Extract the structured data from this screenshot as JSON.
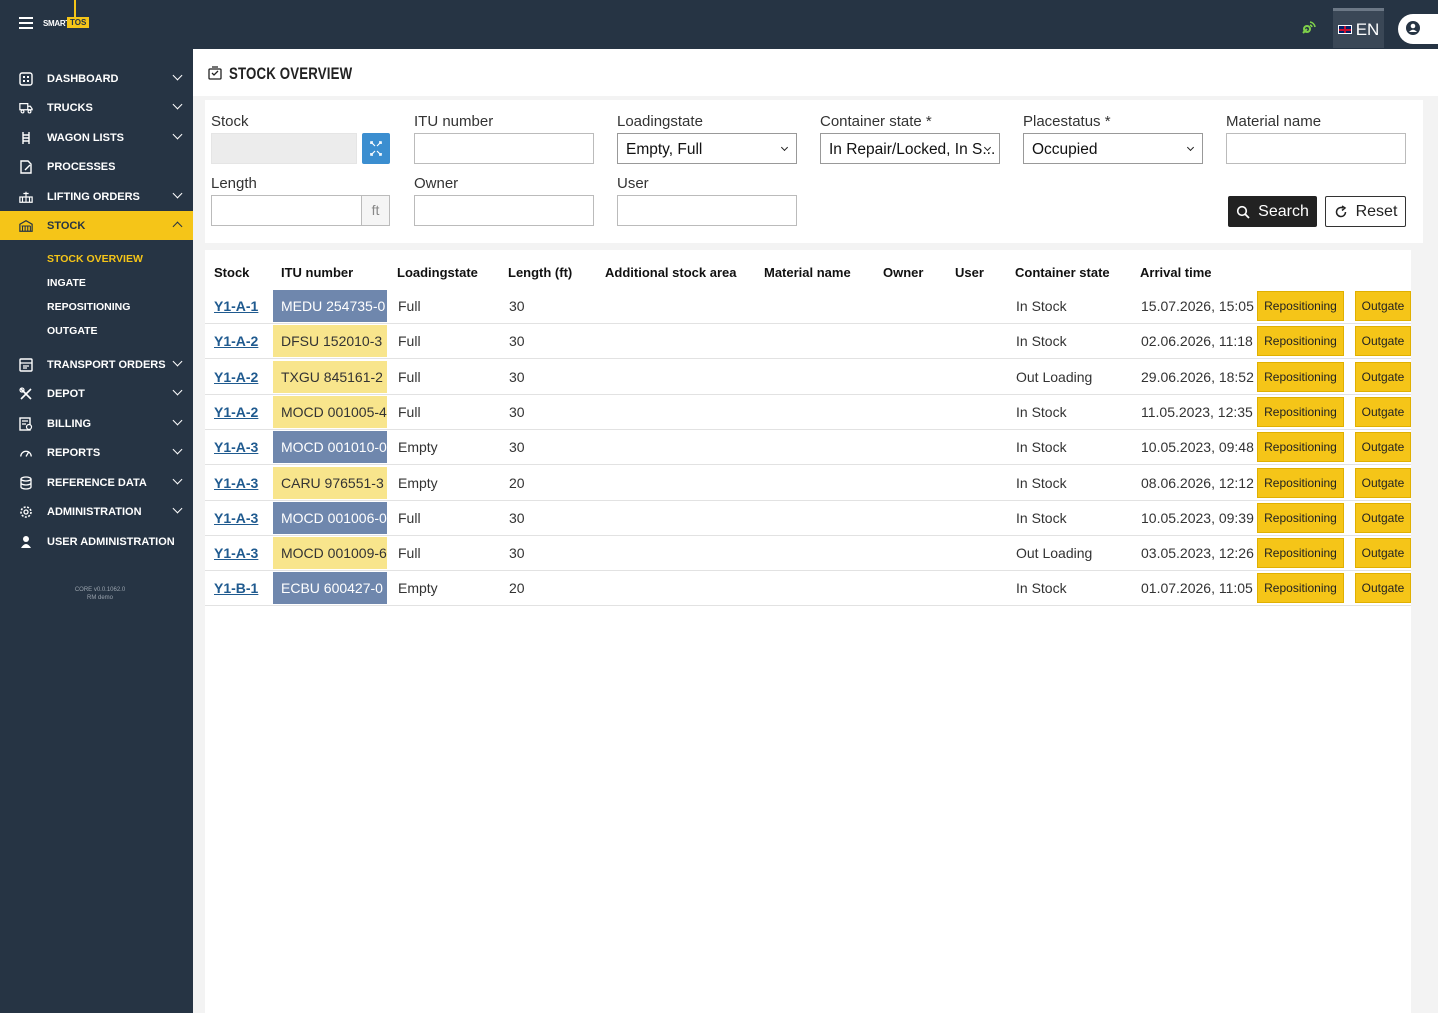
{
  "app": {
    "logo_smart": "SMART",
    "logo_tos": "TOS",
    "language": "EN",
    "version_line1": "CORE v0.0.1062.0",
    "version_line2": "RM demo"
  },
  "sidebar": {
    "items": [
      {
        "label": "DASHBOARD",
        "icon": "dashboard-icon",
        "chevron": true
      },
      {
        "label": "TRUCKS",
        "icon": "truck-icon",
        "chevron": true
      },
      {
        "label": "WAGON LISTS",
        "icon": "wagon-icon",
        "chevron": true
      },
      {
        "label": "PROCESSES",
        "icon": "process-icon",
        "chevron": false
      },
      {
        "label": "LIFTING ORDERS",
        "icon": "crane-icon",
        "chevron": true
      },
      {
        "label": "STOCK",
        "icon": "warehouse-icon",
        "chevron": true,
        "active": true
      },
      {
        "label": "TRANSPORT ORDERS",
        "icon": "transport-icon",
        "chevron": true
      },
      {
        "label": "DEPOT",
        "icon": "tools-icon",
        "chevron": true
      },
      {
        "label": "BILLING",
        "icon": "billing-icon",
        "chevron": true
      },
      {
        "label": "REPORTS",
        "icon": "gauge-icon",
        "chevron": true
      },
      {
        "label": "REFERENCE DATA",
        "icon": "database-icon",
        "chevron": true
      },
      {
        "label": "ADMINISTRATION",
        "icon": "gear-icon",
        "chevron": true
      },
      {
        "label": "USER ADMINISTRATION",
        "icon": "user-icon",
        "chevron": false
      }
    ],
    "stock_sub": [
      "STOCK OVERVIEW",
      "INGATE",
      "REPOSITIONING",
      "OUTGATE"
    ]
  },
  "page": {
    "title": "STOCK OVERVIEW"
  },
  "filters": {
    "stock_label": "Stock",
    "itu_label": "ITU number",
    "loadingstate_label": "Loadingstate",
    "loadingstate_value": "Empty, Full",
    "container_state_label": "Container state *",
    "container_state_value": "In Repair/Locked, In S...",
    "placestatus_label": "Placestatus *",
    "placestatus_value": "Occupied",
    "material_label": "Material name",
    "length_label": "Length",
    "length_unit": "ft",
    "owner_label": "Owner",
    "user_label": "User",
    "search_label": "Search",
    "reset_label": "Reset"
  },
  "table": {
    "headers": [
      "Stock",
      "ITU number",
      "Loadingstate",
      "Length (ft)",
      "Additional stock area",
      "Material name",
      "Owner",
      "User",
      "Container state",
      "Arrival time"
    ],
    "repositioning_label": "Repositioning",
    "outgate_label": "Outgate",
    "rows": [
      {
        "stock": "Y1-A-1",
        "itu": "MEDU 254735-0",
        "itu_color": "blue",
        "loading": "Full",
        "length": "30",
        "state": "In Stock",
        "arrival": "15.07.2026, 15:05"
      },
      {
        "stock": "Y1-A-2",
        "itu": "DFSU 152010-3",
        "itu_color": "yellow",
        "loading": "Full",
        "length": "30",
        "state": "In Stock",
        "arrival": "02.06.2026, 11:18"
      },
      {
        "stock": "Y1-A-2",
        "itu": "TXGU 845161-2",
        "itu_color": "yellow",
        "loading": "Full",
        "length": "30",
        "state": "Out Loading",
        "arrival": "29.06.2026, 18:52"
      },
      {
        "stock": "Y1-A-2",
        "itu": "MOCD 001005-4",
        "itu_color": "yellow",
        "loading": "Full",
        "length": "30",
        "state": "In Stock",
        "arrival": "11.05.2023, 12:35"
      },
      {
        "stock": "Y1-A-3",
        "itu": "MOCD 001010-0",
        "itu_color": "blue",
        "loading": "Empty",
        "length": "30",
        "state": "In Stock",
        "arrival": "10.05.2023, 09:48"
      },
      {
        "stock": "Y1-A-3",
        "itu": "CARU 976551-3",
        "itu_color": "yellow",
        "loading": "Empty",
        "length": "20",
        "state": "In Stock",
        "arrival": "08.06.2026, 12:12"
      },
      {
        "stock": "Y1-A-3",
        "itu": "MOCD 001006-0",
        "itu_color": "blue",
        "loading": "Full",
        "length": "30",
        "state": "In Stock",
        "arrival": "10.05.2023, 09:39"
      },
      {
        "stock": "Y1-A-3",
        "itu": "MOCD 001009-6",
        "itu_color": "yellow",
        "loading": "Full",
        "length": "30",
        "state": "Out Loading",
        "arrival": "03.05.2023, 12:26"
      },
      {
        "stock": "Y1-B-1",
        "itu": "ECBU 600427-0",
        "itu_color": "blue",
        "loading": "Empty",
        "length": "20",
        "state": "In Stock",
        "arrival": "01.07.2026, 11:05"
      }
    ]
  },
  "colors": {
    "sidebar_bg": "#263444",
    "accent_yellow": "#f5c518",
    "itu_blue": "#6f87ad",
    "itu_yellow": "#f8e58c"
  }
}
